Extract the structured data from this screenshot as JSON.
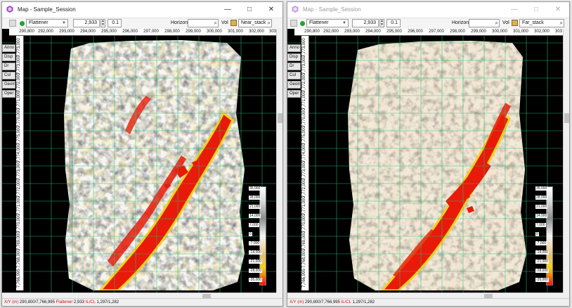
{
  "windows": [
    {
      "title": "Map - Sample_Session",
      "active": true,
      "method": "Flattener",
      "value": "2,933",
      "step": "0.1",
      "horizon_label": "Horizon",
      "horizon_value": "",
      "vol_label": "Vol",
      "volume": "Near_stack",
      "x_ticks": [
        "290,800",
        "292,000",
        "293,000",
        "294,000",
        "295,000",
        "296,000",
        "297,000",
        "298,000",
        "299,000",
        "300,000",
        "301,000",
        "302,000",
        "303"
      ],
      "y_ticks": [
        "7,773,000",
        "7,773,000",
        "7,772,000",
        "7,771,000",
        "7,770,000",
        "7,775,000",
        "7,774,000",
        "7,773,000",
        "7,772,000",
        "7,771,000",
        "7,770,000",
        "7,769,000",
        "7,768,000",
        "7,766,995"
      ],
      "side_tabs": [
        "Anno",
        "Disp",
        "Dr",
        "Cul",
        "Geom",
        "Oper"
      ],
      "colorbar_labels": [
        "35,000",
        "28,000",
        "21,000",
        "14,000",
        "7,000",
        "0",
        "-7,000",
        "-14,000",
        "-21,000",
        "-28,000",
        "-35,000"
      ],
      "status": {
        "xy_label": "X/Y (m)",
        "xy_value": "290,800/7,766,995",
        "flat_label": "Flattener",
        "flat_value": "2,933",
        "ilcl_label": "IL/CL",
        "ilcl_value": "1,297/1,282"
      }
    },
    {
      "title": "Map - Sample_Session",
      "active": false,
      "method": "Flattener",
      "value": "2,933",
      "step": "0.1",
      "horizon_label": "Horizon",
      "horizon_value": "",
      "vol_label": "Vol",
      "volume": "Far_stack",
      "x_ticks": [
        "290,800",
        "292,000",
        "293,000",
        "294,000",
        "295,000",
        "296,000",
        "297,000",
        "298,000",
        "299,000",
        "300,000",
        "301,000",
        "302,000",
        "303"
      ],
      "y_ticks": [
        "7,773,000",
        "7,773,000",
        "7,772,000",
        "7,771,000",
        "7,770,000",
        "7,775,000",
        "7,774,000",
        "7,773,000",
        "7,772,000",
        "7,771,000",
        "7,770,000",
        "7,769,000",
        "7,768,000",
        "7,766,995"
      ],
      "side_tabs": [
        "Anno",
        "Disp",
        "Dr",
        "Cul",
        "Geom",
        "Oper"
      ],
      "colorbar_labels": [
        "35,000",
        "28,000",
        "21,000",
        "14,000",
        "7,000",
        "0",
        "-7,000",
        "-14,000",
        "-21,000",
        "-28,000",
        "-35,000"
      ],
      "status": {
        "xy_label": "X/Y (m)",
        "xy_value": "290,800/7,766,995",
        "flat_label": "",
        "flat_value": "",
        "ilcl_label": "IL/CL",
        "ilcl_value": "1,297/1,282"
      }
    }
  ],
  "colors": {
    "fault": "#e81a0a",
    "amp_yellow": "#f5d21a",
    "green_grid": "#2bbf7a",
    "status_key": "#d01010"
  }
}
